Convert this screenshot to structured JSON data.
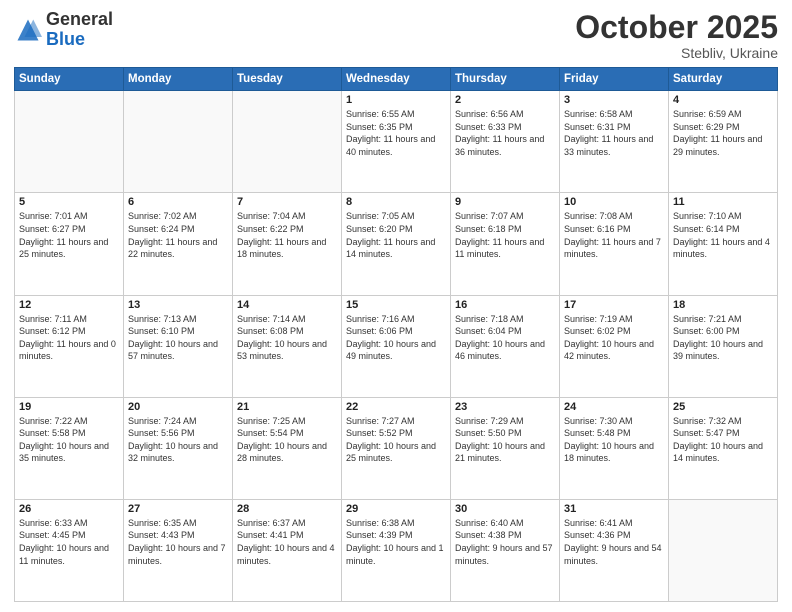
{
  "header": {
    "logo_general": "General",
    "logo_blue": "Blue",
    "month": "October 2025",
    "location": "Stebliv, Ukraine"
  },
  "days_of_week": [
    "Sunday",
    "Monday",
    "Tuesday",
    "Wednesday",
    "Thursday",
    "Friday",
    "Saturday"
  ],
  "weeks": [
    [
      {
        "day": "",
        "info": ""
      },
      {
        "day": "",
        "info": ""
      },
      {
        "day": "",
        "info": ""
      },
      {
        "day": "1",
        "info": "Sunrise: 6:55 AM\nSunset: 6:35 PM\nDaylight: 11 hours\nand 40 minutes."
      },
      {
        "day": "2",
        "info": "Sunrise: 6:56 AM\nSunset: 6:33 PM\nDaylight: 11 hours\nand 36 minutes."
      },
      {
        "day": "3",
        "info": "Sunrise: 6:58 AM\nSunset: 6:31 PM\nDaylight: 11 hours\nand 33 minutes."
      },
      {
        "day": "4",
        "info": "Sunrise: 6:59 AM\nSunset: 6:29 PM\nDaylight: 11 hours\nand 29 minutes."
      }
    ],
    [
      {
        "day": "5",
        "info": "Sunrise: 7:01 AM\nSunset: 6:27 PM\nDaylight: 11 hours\nand 25 minutes."
      },
      {
        "day": "6",
        "info": "Sunrise: 7:02 AM\nSunset: 6:24 PM\nDaylight: 11 hours\nand 22 minutes."
      },
      {
        "day": "7",
        "info": "Sunrise: 7:04 AM\nSunset: 6:22 PM\nDaylight: 11 hours\nand 18 minutes."
      },
      {
        "day": "8",
        "info": "Sunrise: 7:05 AM\nSunset: 6:20 PM\nDaylight: 11 hours\nand 14 minutes."
      },
      {
        "day": "9",
        "info": "Sunrise: 7:07 AM\nSunset: 6:18 PM\nDaylight: 11 hours\nand 11 minutes."
      },
      {
        "day": "10",
        "info": "Sunrise: 7:08 AM\nSunset: 6:16 PM\nDaylight: 11 hours\nand 7 minutes."
      },
      {
        "day": "11",
        "info": "Sunrise: 7:10 AM\nSunset: 6:14 PM\nDaylight: 11 hours\nand 4 minutes."
      }
    ],
    [
      {
        "day": "12",
        "info": "Sunrise: 7:11 AM\nSunset: 6:12 PM\nDaylight: 11 hours\nand 0 minutes."
      },
      {
        "day": "13",
        "info": "Sunrise: 7:13 AM\nSunset: 6:10 PM\nDaylight: 10 hours\nand 57 minutes."
      },
      {
        "day": "14",
        "info": "Sunrise: 7:14 AM\nSunset: 6:08 PM\nDaylight: 10 hours\nand 53 minutes."
      },
      {
        "day": "15",
        "info": "Sunrise: 7:16 AM\nSunset: 6:06 PM\nDaylight: 10 hours\nand 49 minutes."
      },
      {
        "day": "16",
        "info": "Sunrise: 7:18 AM\nSunset: 6:04 PM\nDaylight: 10 hours\nand 46 minutes."
      },
      {
        "day": "17",
        "info": "Sunrise: 7:19 AM\nSunset: 6:02 PM\nDaylight: 10 hours\nand 42 minutes."
      },
      {
        "day": "18",
        "info": "Sunrise: 7:21 AM\nSunset: 6:00 PM\nDaylight: 10 hours\nand 39 minutes."
      }
    ],
    [
      {
        "day": "19",
        "info": "Sunrise: 7:22 AM\nSunset: 5:58 PM\nDaylight: 10 hours\nand 35 minutes."
      },
      {
        "day": "20",
        "info": "Sunrise: 7:24 AM\nSunset: 5:56 PM\nDaylight: 10 hours\nand 32 minutes."
      },
      {
        "day": "21",
        "info": "Sunrise: 7:25 AM\nSunset: 5:54 PM\nDaylight: 10 hours\nand 28 minutes."
      },
      {
        "day": "22",
        "info": "Sunrise: 7:27 AM\nSunset: 5:52 PM\nDaylight: 10 hours\nand 25 minutes."
      },
      {
        "day": "23",
        "info": "Sunrise: 7:29 AM\nSunset: 5:50 PM\nDaylight: 10 hours\nand 21 minutes."
      },
      {
        "day": "24",
        "info": "Sunrise: 7:30 AM\nSunset: 5:48 PM\nDaylight: 10 hours\nand 18 minutes."
      },
      {
        "day": "25",
        "info": "Sunrise: 7:32 AM\nSunset: 5:47 PM\nDaylight: 10 hours\nand 14 minutes."
      }
    ],
    [
      {
        "day": "26",
        "info": "Sunrise: 6:33 AM\nSunset: 4:45 PM\nDaylight: 10 hours\nand 11 minutes."
      },
      {
        "day": "27",
        "info": "Sunrise: 6:35 AM\nSunset: 4:43 PM\nDaylight: 10 hours\nand 7 minutes."
      },
      {
        "day": "28",
        "info": "Sunrise: 6:37 AM\nSunset: 4:41 PM\nDaylight: 10 hours\nand 4 minutes."
      },
      {
        "day": "29",
        "info": "Sunrise: 6:38 AM\nSunset: 4:39 PM\nDaylight: 10 hours\nand 1 minute."
      },
      {
        "day": "30",
        "info": "Sunrise: 6:40 AM\nSunset: 4:38 PM\nDaylight: 9 hours\nand 57 minutes."
      },
      {
        "day": "31",
        "info": "Sunrise: 6:41 AM\nSunset: 4:36 PM\nDaylight: 9 hours\nand 54 minutes."
      },
      {
        "day": "",
        "info": ""
      }
    ]
  ]
}
